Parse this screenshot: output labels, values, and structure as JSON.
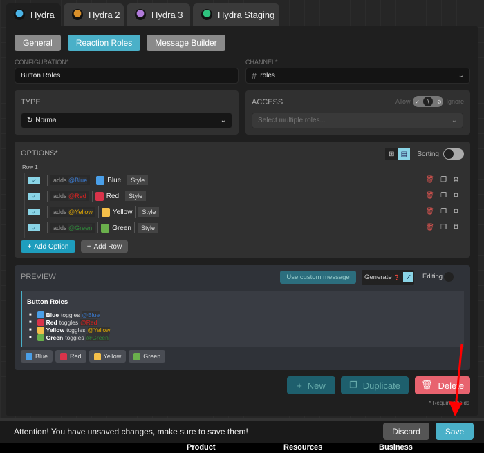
{
  "tabs": [
    {
      "label": "Hydra",
      "color": "#4ab3e6",
      "active": true
    },
    {
      "label": "Hydra 2",
      "color": "#d9902a"
    },
    {
      "label": "Hydra 3",
      "color": "#b07ad9"
    },
    {
      "label": "Hydra Staging",
      "color": "#2ec27e"
    }
  ],
  "subtabs": [
    "General",
    "Reaction Roles",
    "Message Builder"
  ],
  "config": {
    "label": "CONFIGURATION*",
    "value": "Button Roles"
  },
  "channel": {
    "label": "CHANNEL*",
    "value": "roles"
  },
  "type": {
    "title": "TYPE",
    "value": "Normal"
  },
  "access": {
    "title": "ACCESS",
    "allow": "Allow",
    "ignore": "Ignore",
    "placeholder": "Select multiple roles..."
  },
  "options": {
    "title": "OPTIONS*",
    "sorting": "Sorting",
    "row_label": "Row 1",
    "adds": "adds",
    "style": "Style",
    "items": [
      {
        "role": "@Blue",
        "label": "Blue",
        "color": "#4a9fe8",
        "rolecolor": "#3a7ad0"
      },
      {
        "role": "@Red",
        "label": "Red",
        "color": "#d9334a",
        "rolecolor": "#e02020"
      },
      {
        "role": "@Yellow",
        "label": "Yellow",
        "color": "#f5c04a",
        "rolecolor": "#e0a800"
      },
      {
        "role": "@Green",
        "label": "Green",
        "color": "#6ab04c",
        "rolecolor": "#2f8a3a"
      }
    ],
    "add_option": "Add Option",
    "add_row": "Add Row"
  },
  "preview": {
    "title": "PREVIEW",
    "custom": "Use custom message",
    "generate": "Generate",
    "editing": "Editing",
    "heading": "Button Roles",
    "toggles": "toggles"
  },
  "actions": {
    "new": "New",
    "duplicate": "Duplicate",
    "delete": "Delete",
    "required": "* Required fields"
  },
  "bar": {
    "message": "Attention! You have unsaved changes, make sure to save them!",
    "discard": "Discard",
    "save": "Save"
  },
  "footer": [
    "Product",
    "Resources",
    "Business"
  ]
}
